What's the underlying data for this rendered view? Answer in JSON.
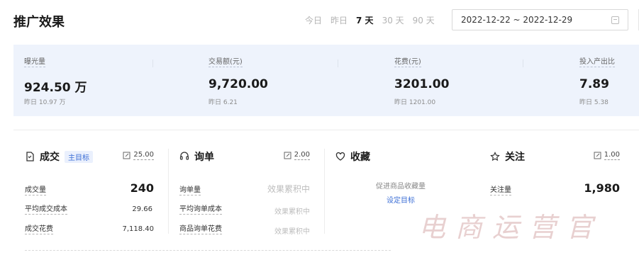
{
  "header": {
    "title": "推广效果",
    "ranges": [
      {
        "label": "今日",
        "active": false
      },
      {
        "label": "昨日",
        "active": false
      },
      {
        "label": "7 天",
        "active": true
      },
      {
        "label": "30 天",
        "active": false
      },
      {
        "label": "90 天",
        "active": false
      }
    ],
    "date_range": "2022-12-22 ~ 2022-12-29"
  },
  "summary": [
    {
      "label": "曝光量",
      "value": "924.50 万",
      "sub": "昨日 10.97 万"
    },
    {
      "label": "交易额(元)",
      "value": "9,720.00",
      "sub": "昨日 6.21"
    },
    {
      "label": "花费(元)",
      "value": "3201.00",
      "sub": "昨日 1201.00"
    },
    {
      "label": "投入产出比",
      "value": "7.89",
      "sub": "昨日 5.38"
    }
  ],
  "cards": {
    "deal": {
      "title": "成交",
      "tag": "主目标",
      "edit_value": "25.00",
      "rows": [
        {
          "label": "成交量",
          "value": "240"
        },
        {
          "label": "平均成交成本",
          "value": "29.66"
        },
        {
          "label": "成交花费",
          "value": "7,118.40"
        }
      ]
    },
    "inquiry": {
      "title": "询单",
      "edit_value": "2.00",
      "rows": [
        {
          "label": "询单量",
          "value": "效果累积中"
        },
        {
          "label": "平均询单成本",
          "value": "效果累积中"
        },
        {
          "label": "商品询单花费",
          "value": "效果累积中"
        }
      ]
    },
    "favorite": {
      "title": "收藏",
      "hint": "促进商品收藏量",
      "link": "设定目标"
    },
    "follow": {
      "title": "关注",
      "edit_value": "1.00",
      "rows": [
        {
          "label": "关注量",
          "value": "1,980"
        }
      ]
    }
  },
  "watermark": "电商运营官",
  "colors": {
    "accent": "#3d6fd6",
    "summary_bg": "#eef3fc"
  }
}
